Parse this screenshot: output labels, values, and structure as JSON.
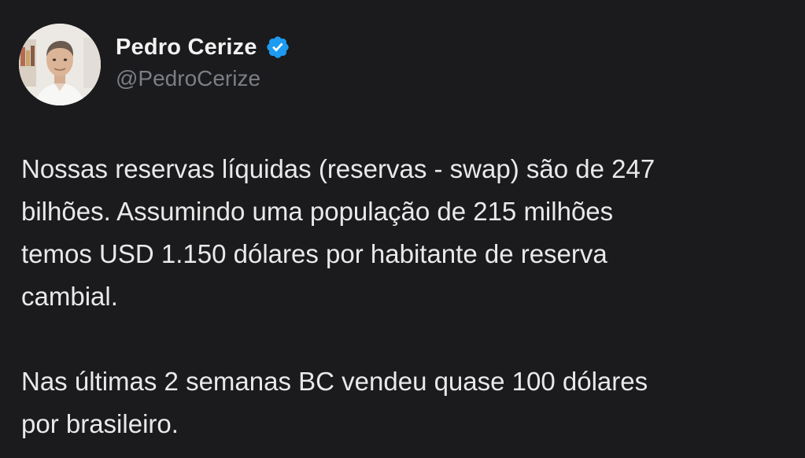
{
  "author": {
    "display_name": "Pedro Cerize",
    "handle": "@PedroCerize",
    "verified": true,
    "verified_icon": "verified-badge-icon",
    "verified_color": "#1d9bf0"
  },
  "tweet": {
    "paragraphs": [
      "Nossas reservas líquidas (reservas - swap) são de 247\nbilhões. Assumindo uma população de 215 milhões\ntemos USD 1.150 dólares por habitante de reserva\ncambial.",
      "Nas últimas 2 semanas BC vendeu quase  100 dólares\npor brasileiro."
    ]
  },
  "colors": {
    "background": "#1b1b1d",
    "text_primary": "#e9e9ea",
    "text_secondary": "#7a7f86"
  }
}
